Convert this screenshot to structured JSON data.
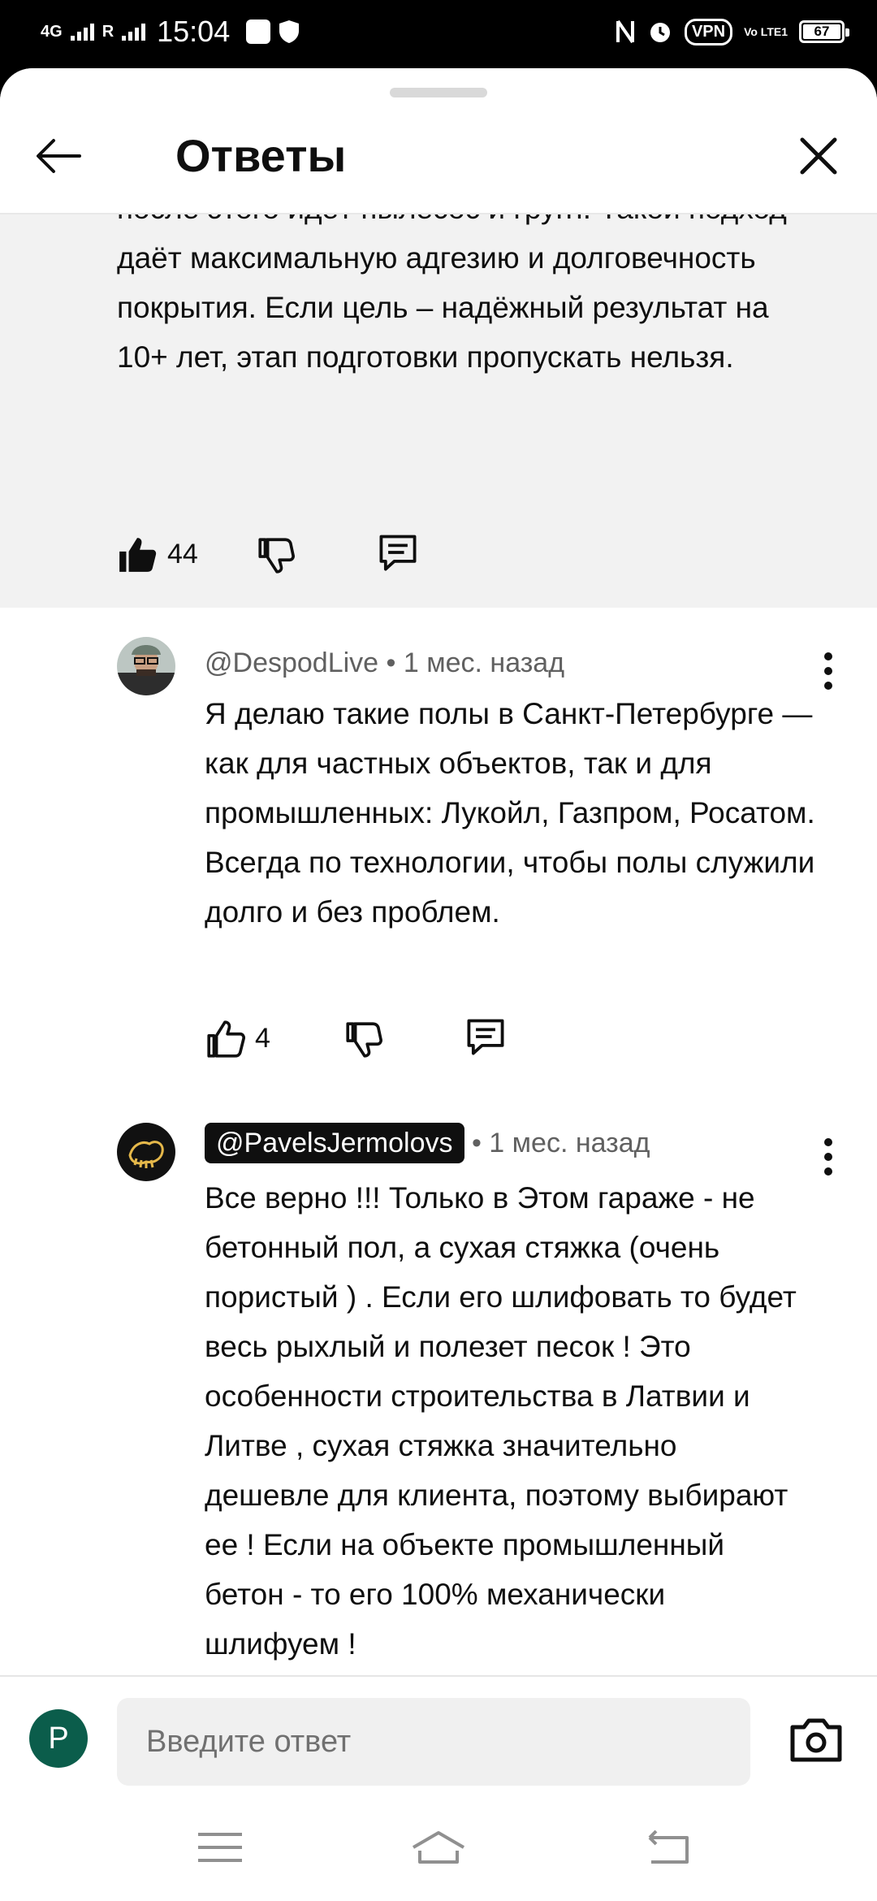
{
  "status_bar": {
    "network": "4G",
    "roaming": "R",
    "time": "15:04",
    "vpn": "VPN",
    "volte": "Vo LTE1",
    "battery": "67"
  },
  "header": {
    "title": "Ответы"
  },
  "parent_comment": {
    "text": "после этого идёт пылесос и грунт. Такой подход даёт максимальную адгезию и долговечность покрытия. Если цель – надёжный результат на 10+ лет, этап подготовки пропускать нельзя.",
    "like_count": "44"
  },
  "replies": [
    {
      "author": "@DespodLive",
      "time": "• 1 мес. назад",
      "text": "Я делаю такие полы в Санкт-Петербурге — как для частных объектов, так и для промышленных: Лукойл, Газпром, Росатом. Всегда по технологии, чтобы полы служили долго и без проблем.",
      "like_count": "4"
    },
    {
      "author": "@PavelsJermolovs",
      "time": "• 1 мес. назад",
      "text": "Все верно !!! Только в Этом гараже - не бетонный пол, а сухая стяжка (очень пористый ) . Если его шлифовать то будет весь рыхлый и полезет песок ! Это особенности строительства в Латвии и Литве , сухая стяжка значительно дешевле для клиента, поэтому выбирают ее ! Если на объекте промышленный бетон - то его 100% механически шлифуем !"
    }
  ],
  "composer": {
    "avatar_letter": "P",
    "placeholder": "Введите ответ"
  },
  "colors": {
    "parent_bg": "#f2f2f2",
    "avatar_bg": "#0b5d4b",
    "author_chip_bg": "#0f0f0f"
  }
}
